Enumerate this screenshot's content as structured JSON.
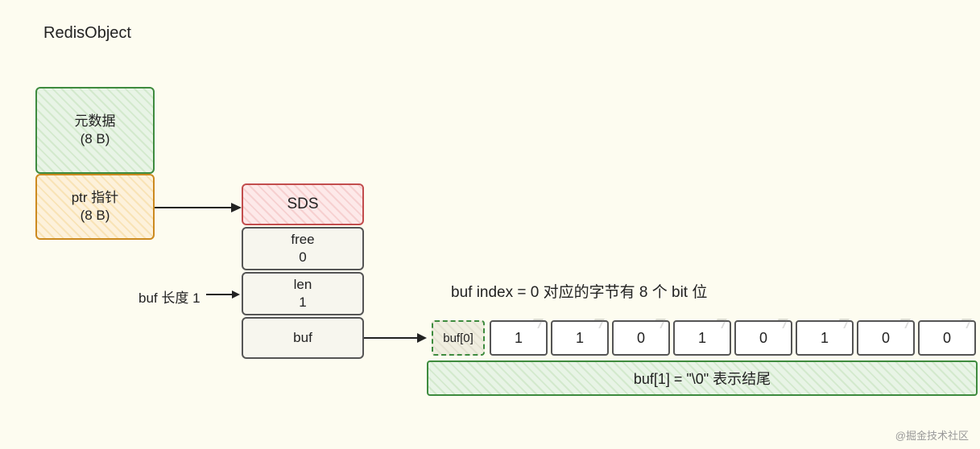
{
  "title": "RedisObject",
  "metaBox": {
    "line1": "元数据",
    "line2": "(8 B)"
  },
  "ptrBox": {
    "line1": "ptr 指针",
    "line2": "(8 B)"
  },
  "sds": {
    "header": "SDS",
    "free": {
      "label": "free",
      "value": "0"
    },
    "len": {
      "label": "len",
      "value": "1"
    },
    "buf": {
      "label": "buf"
    }
  },
  "bufLenLabel": "buf 长度 1",
  "bitCaption": "buf index =  0 对应的字节有 8 个 bit 位",
  "buf0Label": "buf[0]",
  "bits": [
    "1",
    "1",
    "0",
    "1",
    "0",
    "1",
    "0",
    "0"
  ],
  "footer": "buf[1]  = \"\\0\" 表示结尾",
  "watermark": "@掘金技术社区"
}
